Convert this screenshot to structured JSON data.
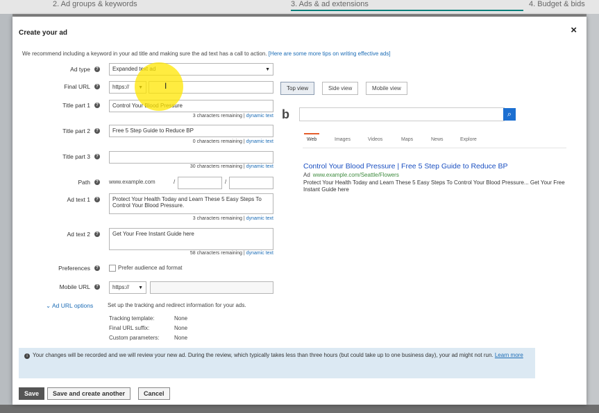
{
  "steps": {
    "step2": "2. Ad groups & keywords",
    "step3": "3. Ads & ad extensions",
    "step4": "4. Budget & bids"
  },
  "dialog": {
    "title": "Create your ad",
    "close": "×",
    "intro_text": "We recommend including a keyword in your ad title and making sure the ad text has a call to action.",
    "intro_link": "[Here are some more tips on writing effective ads]"
  },
  "form": {
    "ad_type": {
      "label": "Ad type",
      "value": "Expanded text ad"
    },
    "final_url": {
      "label": "Final URL",
      "protocol": "https://",
      "value": ""
    },
    "title1": {
      "label": "Title part 1",
      "value": "Control Your Blood Pressure",
      "remaining": "3 characters remaining"
    },
    "title2": {
      "label": "Title part 2",
      "value": "Free 5 Step Guide to Reduce BP",
      "remaining": "0 characters remaining"
    },
    "title3": {
      "label": "Title part 3",
      "value": "",
      "remaining": "30 characters remaining"
    },
    "path": {
      "label": "Path",
      "domain": "www.example.com",
      "sep": "/"
    },
    "ad_text1": {
      "label": "Ad text 1",
      "value": "Protect Your Health Today and Learn These 5 Easy Steps To Control Your Blood Pressure.",
      "remaining": "3 characters remaining"
    },
    "ad_text2": {
      "label": "Ad text 2",
      "value": "Get Your Free Instant Guide here",
      "remaining": "58 characters remaining"
    },
    "dynamic_text": "dynamic text",
    "preferences": {
      "label": "Preferences",
      "checkbox": "Prefer audience ad format"
    },
    "mobile_url": {
      "label": "Mobile URL",
      "protocol": "https://"
    },
    "url_options": {
      "label": "Ad URL options",
      "desc": "Set up the tracking and redirect information for your ads."
    },
    "tracking": [
      {
        "label": "Tracking template:",
        "value": "None"
      },
      {
        "label": "Final URL suffix:",
        "value": "None"
      },
      {
        "label": "Custom parameters:",
        "value": "None"
      }
    ]
  },
  "preview": {
    "views": [
      "Top view",
      "Side view",
      "Mobile view"
    ],
    "tabs": [
      "Web",
      "Images",
      "Videos",
      "Maps",
      "News",
      "Explore"
    ],
    "ad_title": "Control Your Blood Pressure | Free 5 Step Guide to Reduce BP",
    "ad_label": "Ad",
    "ad_url": "www.example.com/Seattle/Flowers",
    "ad_desc": "Protect Your Health Today and Learn These 5 Easy Steps To Control Your Blood Pressure... Get Your Free Instant Guide here"
  },
  "notice": {
    "text": "Your changes will be recorded and we will review your new ad. During the review, which typically takes less than three hours (but could take up to one business day), your ad might not run.",
    "link": "Learn more"
  },
  "buttons": {
    "save": "Save",
    "save_another": "Save and create another",
    "cancel": "Cancel"
  },
  "colors": {
    "accent": "#1a6bb5",
    "bing_blue": "#1c6fd1",
    "active_tab": "#e45c2a"
  }
}
